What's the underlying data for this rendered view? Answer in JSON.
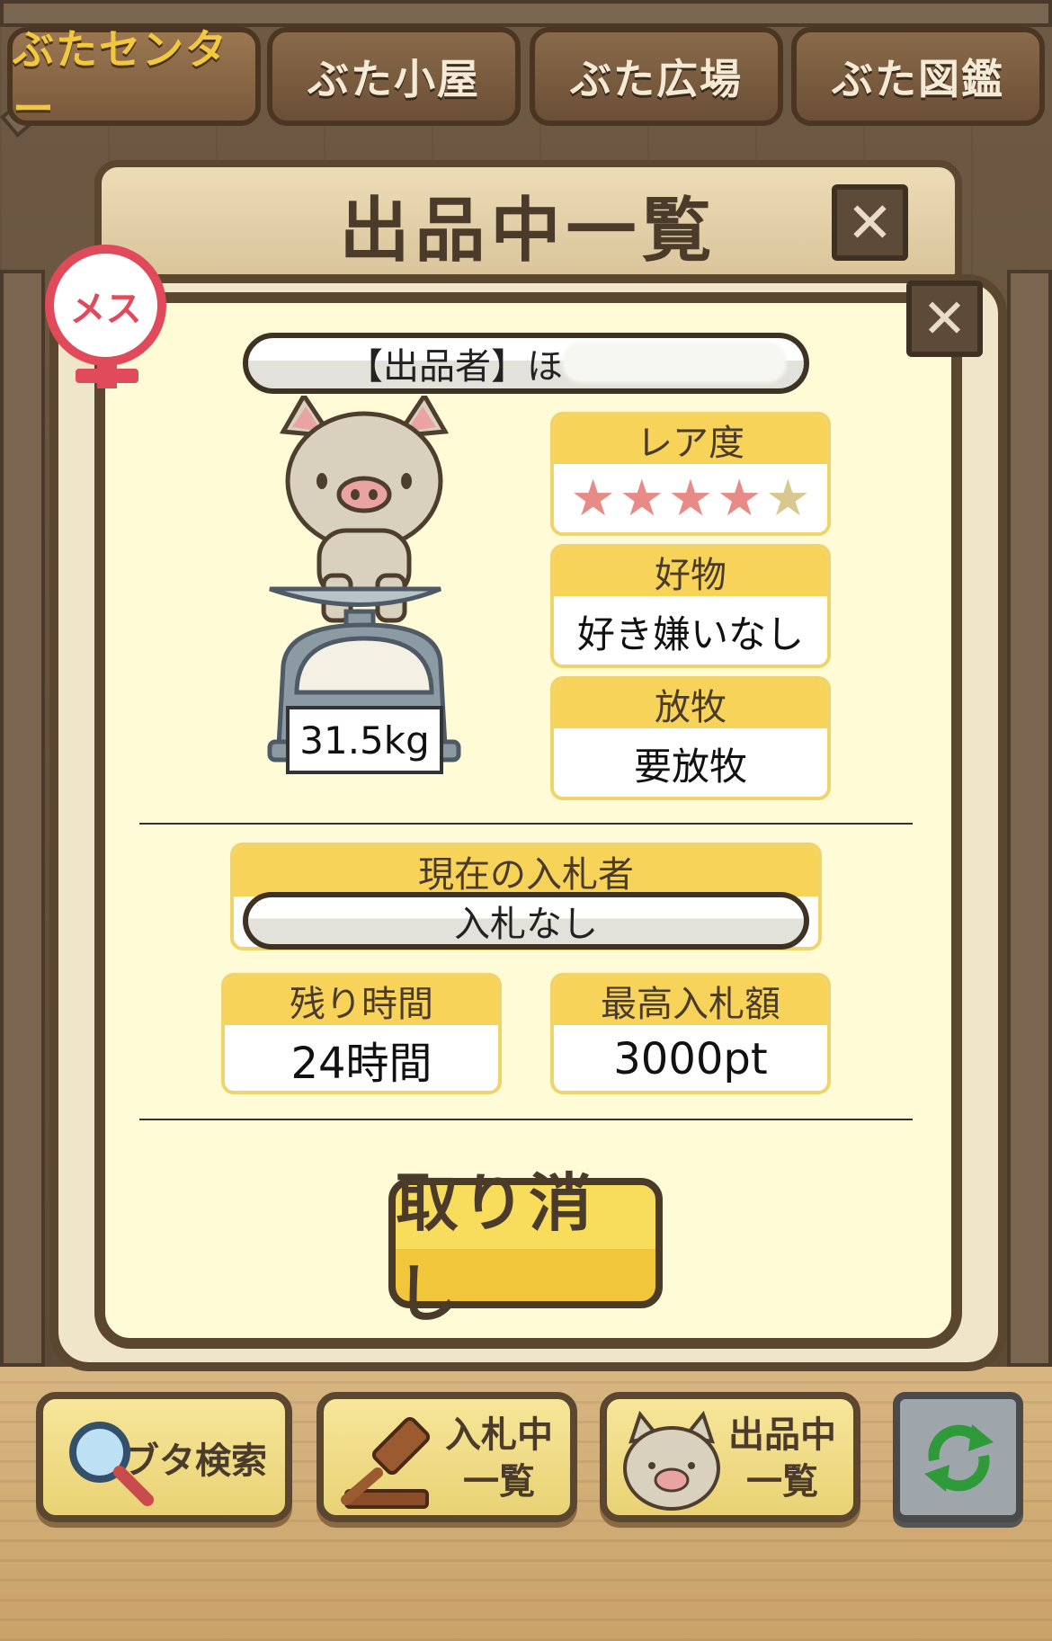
{
  "tabs": [
    {
      "label": "ぶたセンター",
      "active": true
    },
    {
      "label": "ぶた小屋",
      "active": false
    },
    {
      "label": "ぶた広場",
      "active": false
    },
    {
      "label": "ぶた図鑑",
      "active": false
    }
  ],
  "modal": {
    "title": "出品中一覧",
    "close_glyph": "✕",
    "gender_badge": "メス",
    "seller_label": "【出品者】ほ",
    "weight": "31.5kg",
    "rarity": {
      "label": "レア度",
      "rating": 4,
      "max": 5
    },
    "favorite": {
      "label": "好物",
      "value": "好き嫌いなし"
    },
    "grazing": {
      "label": "放牧",
      "value": "要放牧"
    },
    "current_bidder": {
      "label": "現在の入札者",
      "value": "入札なし"
    },
    "remaining_time": {
      "label": "残り時間",
      "value": "24時間"
    },
    "highest_bid": {
      "label": "最高入札額",
      "value": "3000pt"
    },
    "cancel_label": "取り消し"
  },
  "colors": {
    "star_filled": "#e88a86",
    "star_empty": "#d8c890",
    "accent_yellow": "#f7d35a",
    "frame_brown": "#5b4630"
  },
  "bottom_bar": {
    "search": {
      "label": "ブタ検索",
      "icon": "magnifier-icon"
    },
    "bidding": {
      "label_line1": "入札中",
      "label_line2": "一覧",
      "icon": "gavel-icon"
    },
    "listing": {
      "label_line1": "出品中",
      "label_line2": "一覧",
      "icon": "pig-face-icon"
    },
    "refresh": {
      "icon": "refresh-icon"
    }
  }
}
